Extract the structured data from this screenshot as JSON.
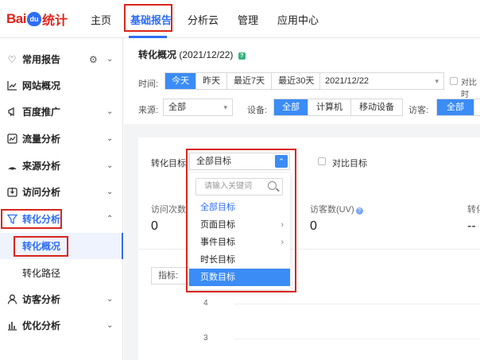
{
  "logo": {
    "bai": "Bai",
    "du": "du",
    "tongji": "统计"
  },
  "nav": {
    "items": [
      "主页",
      "基础报告",
      "分析云",
      "管理",
      "应用中心"
    ],
    "active_index": 1
  },
  "sidebar": {
    "items": [
      {
        "label": "常用报告",
        "icon": "heart-icon"
      },
      {
        "label": "网站概况",
        "icon": "chart-line-icon"
      },
      {
        "label": "百度推广",
        "icon": "megaphone-icon"
      },
      {
        "label": "流量分析",
        "icon": "image-chart-icon"
      },
      {
        "label": "来源分析",
        "icon": "radar-icon"
      },
      {
        "label": "访问分析",
        "icon": "enter-icon"
      },
      {
        "label": "转化分析",
        "icon": "funnel-icon"
      },
      {
        "label": "访客分析",
        "icon": "user-icon"
      },
      {
        "label": "优化分析",
        "icon": "bar-chart-icon"
      }
    ],
    "subitems": [
      "转化概况",
      "转化路径"
    ]
  },
  "page": {
    "title": "转化概况",
    "date": "(2021/12/22)"
  },
  "filters": {
    "time_label": "时间:",
    "time_options": [
      "今天",
      "昨天",
      "最近7天",
      "最近30天"
    ],
    "date_value": "2021/12/22",
    "compare_label": "对比时",
    "source_label": "来源:",
    "source_value": "全部",
    "device_label": "设备:",
    "device_options": [
      "全部",
      "计算机",
      "移动设备"
    ],
    "visitor_label": "访客:",
    "visitor_options": [
      "全部"
    ]
  },
  "card": {
    "target_label": "转化目标",
    "target_value": "全部目标",
    "compare_target_label": "对比目标",
    "metrics": [
      {
        "label": "访问次数",
        "value": "0"
      },
      {
        "label": "访客数(UV)",
        "value": "0"
      },
      {
        "label": "转化",
        "value": "--"
      }
    ],
    "indicator_label": "指标:",
    "axis_ticks": [
      "4",
      "3"
    ]
  },
  "dropdown": {
    "search_placeholder": "请输入关键词",
    "options": [
      {
        "label": "全部目标",
        "has_sub": false
      },
      {
        "label": "页面目标",
        "has_sub": true
      },
      {
        "label": "事件目标",
        "has_sub": true
      },
      {
        "label": "时长目标",
        "has_sub": false
      },
      {
        "label": "页数目标",
        "has_sub": false
      }
    ],
    "selected_index": 4
  },
  "colors": {
    "accent": "#3b8cf5",
    "brand_red": "#e1251b",
    "highlight_red": "#d9251c"
  }
}
